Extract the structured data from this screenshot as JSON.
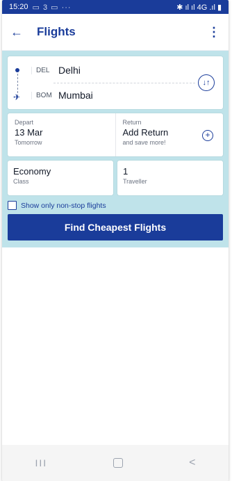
{
  "status_bar": {
    "time": "15:20",
    "left_icons": "▭ 3 ▭ ···",
    "right_icons": "✱ ıl ıl 4G .ıl ▮"
  },
  "app_bar": {
    "title": "Flights",
    "back_icon": "arrow-left-icon",
    "menu_icon": "more-vertical-icon"
  },
  "route": {
    "origin_code": "DEL",
    "origin_city": "Delhi",
    "destination_code": "BOM",
    "destination_city": "Mumbai",
    "swap_symbol": "↓↑"
  },
  "dates": {
    "depart_label": "Depart",
    "depart_date": "13 Mar",
    "depart_sub": "Tomorrow",
    "return_label": "Return",
    "return_value": "Add Return",
    "return_sub": "and save more!",
    "add_return_symbol": "+"
  },
  "travel": {
    "class_value": "Economy",
    "class_label": "Class",
    "traveller_value": "1",
    "traveller_label": "Traveller"
  },
  "nonstop": {
    "label": "Show only non-stop flights",
    "checked": false
  },
  "cta": {
    "label": "Find Cheapest Flights"
  },
  "nav": {
    "recents": "III",
    "back": "<"
  },
  "colors": {
    "brand": "#1a3c9a",
    "panel": "#bfe3ea",
    "status_bar": "#1a3c9a"
  }
}
